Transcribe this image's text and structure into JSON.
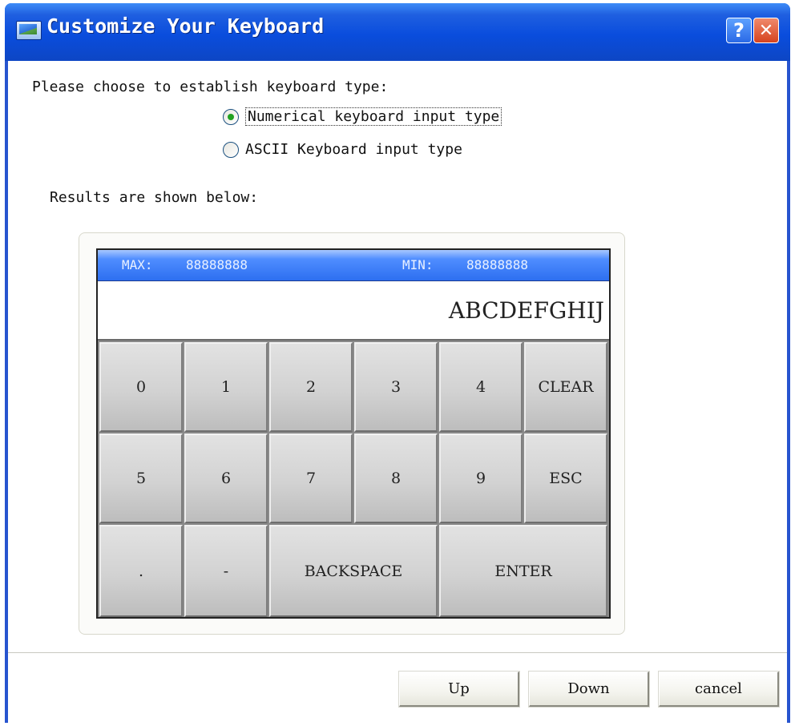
{
  "window": {
    "title": "Customize Your Keyboard",
    "help_label": "?",
    "close_label": "✕"
  },
  "form": {
    "prompt": "Please choose to establish keyboard type:",
    "options": [
      {
        "label": "Numerical keyboard input type",
        "checked": true
      },
      {
        "label": "ASCII Keyboard input type",
        "checked": false
      }
    ],
    "results_label": "Results are shown below:"
  },
  "keypad": {
    "max_label": "MAX:",
    "max_value": "88888888",
    "min_label": "MIN:",
    "min_value": "88888888",
    "display_text": "ABCDEFGHIJ",
    "keys": [
      "0",
      "1",
      "2",
      "3",
      "4",
      "CLEAR",
      "5",
      "6",
      "7",
      "8",
      "9",
      "ESC",
      ".",
      "-",
      "BACKSPACE",
      "ENTER"
    ]
  },
  "footer": {
    "up_label": "Up",
    "down_label": "Down",
    "cancel_label": "cancel"
  },
  "colors": {
    "titlebar": "#0a4ddd",
    "keypad_header": "#2d6ff0",
    "radio_selected": "#21a121"
  }
}
